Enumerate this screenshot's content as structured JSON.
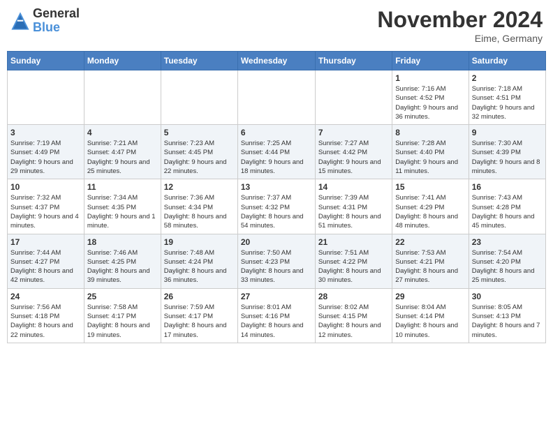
{
  "header": {
    "logo_line1": "General",
    "logo_line2": "Blue",
    "month_title": "November 2024",
    "location": "Eime, Germany"
  },
  "days_of_week": [
    "Sunday",
    "Monday",
    "Tuesday",
    "Wednesday",
    "Thursday",
    "Friday",
    "Saturday"
  ],
  "weeks": [
    [
      {
        "day": "",
        "detail": ""
      },
      {
        "day": "",
        "detail": ""
      },
      {
        "day": "",
        "detail": ""
      },
      {
        "day": "",
        "detail": ""
      },
      {
        "day": "",
        "detail": ""
      },
      {
        "day": "1",
        "detail": "Sunrise: 7:16 AM\nSunset: 4:52 PM\nDaylight: 9 hours and 36 minutes."
      },
      {
        "day": "2",
        "detail": "Sunrise: 7:18 AM\nSunset: 4:51 PM\nDaylight: 9 hours and 32 minutes."
      }
    ],
    [
      {
        "day": "3",
        "detail": "Sunrise: 7:19 AM\nSunset: 4:49 PM\nDaylight: 9 hours and 29 minutes."
      },
      {
        "day": "4",
        "detail": "Sunrise: 7:21 AM\nSunset: 4:47 PM\nDaylight: 9 hours and 25 minutes."
      },
      {
        "day": "5",
        "detail": "Sunrise: 7:23 AM\nSunset: 4:45 PM\nDaylight: 9 hours and 22 minutes."
      },
      {
        "day": "6",
        "detail": "Sunrise: 7:25 AM\nSunset: 4:44 PM\nDaylight: 9 hours and 18 minutes."
      },
      {
        "day": "7",
        "detail": "Sunrise: 7:27 AM\nSunset: 4:42 PM\nDaylight: 9 hours and 15 minutes."
      },
      {
        "day": "8",
        "detail": "Sunrise: 7:28 AM\nSunset: 4:40 PM\nDaylight: 9 hours and 11 minutes."
      },
      {
        "day": "9",
        "detail": "Sunrise: 7:30 AM\nSunset: 4:39 PM\nDaylight: 9 hours and 8 minutes."
      }
    ],
    [
      {
        "day": "10",
        "detail": "Sunrise: 7:32 AM\nSunset: 4:37 PM\nDaylight: 9 hours and 4 minutes."
      },
      {
        "day": "11",
        "detail": "Sunrise: 7:34 AM\nSunset: 4:35 PM\nDaylight: 9 hours and 1 minute."
      },
      {
        "day": "12",
        "detail": "Sunrise: 7:36 AM\nSunset: 4:34 PM\nDaylight: 8 hours and 58 minutes."
      },
      {
        "day": "13",
        "detail": "Sunrise: 7:37 AM\nSunset: 4:32 PM\nDaylight: 8 hours and 54 minutes."
      },
      {
        "day": "14",
        "detail": "Sunrise: 7:39 AM\nSunset: 4:31 PM\nDaylight: 8 hours and 51 minutes."
      },
      {
        "day": "15",
        "detail": "Sunrise: 7:41 AM\nSunset: 4:29 PM\nDaylight: 8 hours and 48 minutes."
      },
      {
        "day": "16",
        "detail": "Sunrise: 7:43 AM\nSunset: 4:28 PM\nDaylight: 8 hours and 45 minutes."
      }
    ],
    [
      {
        "day": "17",
        "detail": "Sunrise: 7:44 AM\nSunset: 4:27 PM\nDaylight: 8 hours and 42 minutes."
      },
      {
        "day": "18",
        "detail": "Sunrise: 7:46 AM\nSunset: 4:25 PM\nDaylight: 8 hours and 39 minutes."
      },
      {
        "day": "19",
        "detail": "Sunrise: 7:48 AM\nSunset: 4:24 PM\nDaylight: 8 hours and 36 minutes."
      },
      {
        "day": "20",
        "detail": "Sunrise: 7:50 AM\nSunset: 4:23 PM\nDaylight: 8 hours and 33 minutes."
      },
      {
        "day": "21",
        "detail": "Sunrise: 7:51 AM\nSunset: 4:22 PM\nDaylight: 8 hours and 30 minutes."
      },
      {
        "day": "22",
        "detail": "Sunrise: 7:53 AM\nSunset: 4:21 PM\nDaylight: 8 hours and 27 minutes."
      },
      {
        "day": "23",
        "detail": "Sunrise: 7:54 AM\nSunset: 4:20 PM\nDaylight: 8 hours and 25 minutes."
      }
    ],
    [
      {
        "day": "24",
        "detail": "Sunrise: 7:56 AM\nSunset: 4:18 PM\nDaylight: 8 hours and 22 minutes."
      },
      {
        "day": "25",
        "detail": "Sunrise: 7:58 AM\nSunset: 4:17 PM\nDaylight: 8 hours and 19 minutes."
      },
      {
        "day": "26",
        "detail": "Sunrise: 7:59 AM\nSunset: 4:17 PM\nDaylight: 8 hours and 17 minutes."
      },
      {
        "day": "27",
        "detail": "Sunrise: 8:01 AM\nSunset: 4:16 PM\nDaylight: 8 hours and 14 minutes."
      },
      {
        "day": "28",
        "detail": "Sunrise: 8:02 AM\nSunset: 4:15 PM\nDaylight: 8 hours and 12 minutes."
      },
      {
        "day": "29",
        "detail": "Sunrise: 8:04 AM\nSunset: 4:14 PM\nDaylight: 8 hours and 10 minutes."
      },
      {
        "day": "30",
        "detail": "Sunrise: 8:05 AM\nSunset: 4:13 PM\nDaylight: 8 hours and 7 minutes."
      }
    ]
  ]
}
